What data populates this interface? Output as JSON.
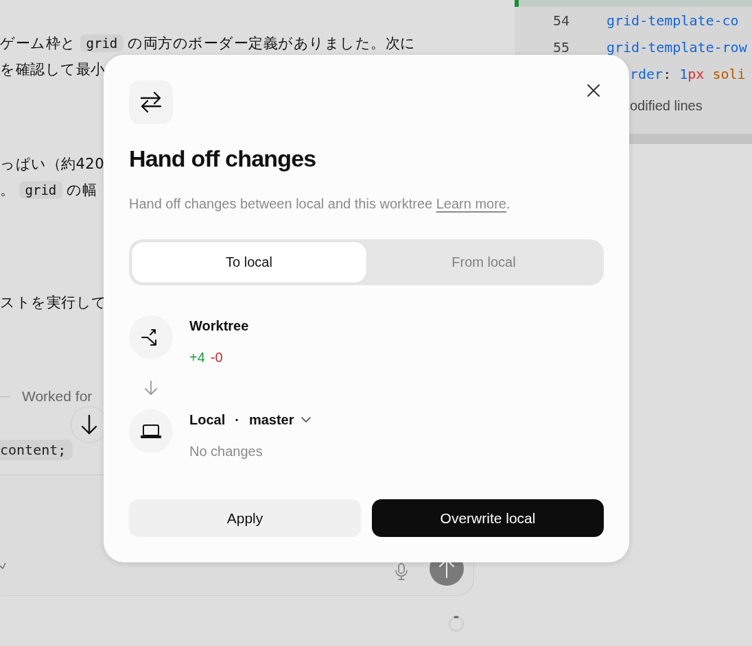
{
  "chat": {
    "paragraphs": [
      [
        {
          "parts": [
            {
              "kind": "text",
              "text": "ゲーム枠と"
            },
            {
              "kind": "code",
              "text": "grid"
            },
            {
              "kind": "text",
              "text": "の両方のボーダー定義がありました。次に"
            }
          ]
        },
        {
          "parts": [
            {
              "kind": "text",
              "text": "を確認して最小"
            }
          ]
        }
      ],
      [
        {
          "parts": [
            {
              "kind": "text",
              "text": "っぱい（約420"
            }
          ]
        },
        {
          "parts": [
            {
              "kind": "text",
              "text": "。"
            },
            {
              "kind": "code",
              "text": "grid"
            },
            {
              "kind": "text",
              "text": "の幅"
            }
          ]
        }
      ],
      [
        {
          "parts": [
            {
              "kind": "text",
              "text": "ストを実行して"
            }
          ]
        }
      ]
    ],
    "worked": "Worked for",
    "code_line": "content;"
  },
  "editor": {
    "lines": [
      {
        "number": "54",
        "tokens": [
          {
            "kind": "property",
            "text": "grid-template-co"
          }
        ]
      },
      {
        "number": "55",
        "tokens": [
          {
            "kind": "property",
            "text": "grid-template-row"
          }
        ]
      },
      {
        "tokens": [
          {
            "kind": "property",
            "text": "rder"
          },
          {
            "kind": "punct",
            "text": ": "
          },
          {
            "kind": "number",
            "text": "1"
          },
          {
            "kind": "unit",
            "text": "px"
          },
          {
            "kind": "keyword",
            "text": "soli"
          }
        ]
      }
    ],
    "note": "odified lines"
  },
  "dialog": {
    "title": "Hand off changes",
    "description": "Hand off changes between local and this worktree",
    "link": "Learn more",
    "description_end": ".",
    "tabs": [
      {
        "label": "To local",
        "selected": true
      },
      {
        "label": "From local",
        "selected": false
      }
    ],
    "source": {
      "title": "Worktree",
      "additions": "+4",
      "deletions": "-0"
    },
    "target": {
      "title": "Local",
      "separator": "·",
      "branch": "master",
      "status": "No changes"
    },
    "buttons": [
      {
        "label": "Apply",
        "kind": "secondary"
      },
      {
        "label": "Overwrite local",
        "kind": "primary"
      }
    ]
  }
}
